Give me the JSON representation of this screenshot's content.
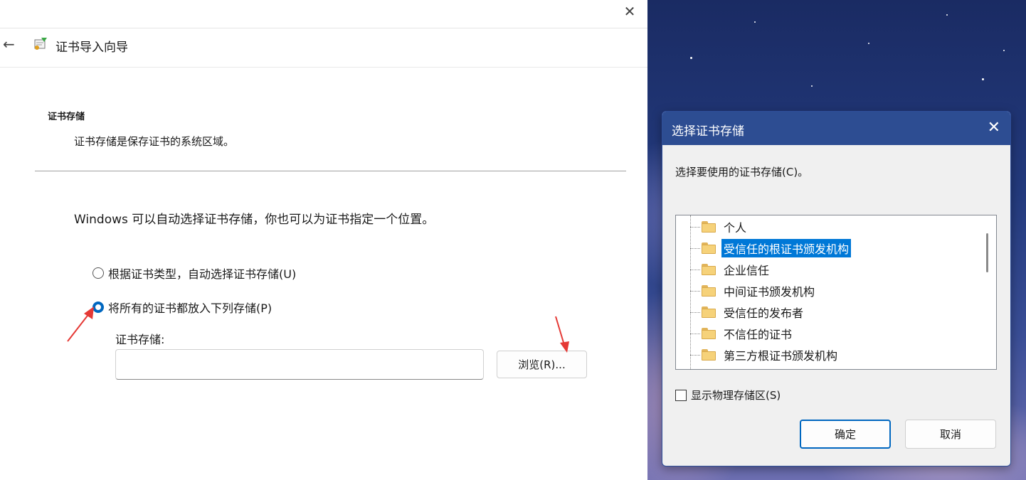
{
  "wizard": {
    "close_icon": "close-icon",
    "back_icon": "back-arrow-icon",
    "app_icon": "certificate-icon",
    "title": "证书导入向导",
    "section_heading": "证书存储",
    "section_description": "证书存储是保存证书的系统区域。",
    "info_text": "Windows 可以自动选择证书存储，你也可以为证书指定一个位置。",
    "options": [
      {
        "label": "根据证书类型，自动选择证书存储(U)",
        "checked": false
      },
      {
        "label": "将所有的证书都放入下列存储(P)",
        "checked": true
      }
    ],
    "store_label": "证书存储:",
    "store_value": "",
    "browse_label": "浏览(R)..."
  },
  "dialog": {
    "title": "选择证书存储",
    "prompt": "选择要使用的证书存储(C)。",
    "stores": [
      {
        "label": "个人",
        "selected": false
      },
      {
        "label": "受信任的根证书颁发机构",
        "selected": true
      },
      {
        "label": "企业信任",
        "selected": false
      },
      {
        "label": "中间证书颁发机构",
        "selected": false
      },
      {
        "label": "受信任的发布者",
        "selected": false
      },
      {
        "label": "不信任的证书",
        "selected": false
      },
      {
        "label": "第三方根证书颁发机构",
        "selected": false
      }
    ],
    "show_physical_label": "显示物理存储区(S)",
    "show_physical_checked": false,
    "ok_label": "确定",
    "cancel_label": "取消"
  },
  "colors": {
    "accent": "#0067c0",
    "selection": "#0078d7",
    "dialog_titlebar": "#2d4d92",
    "annotation_arrow": "#e53935"
  }
}
